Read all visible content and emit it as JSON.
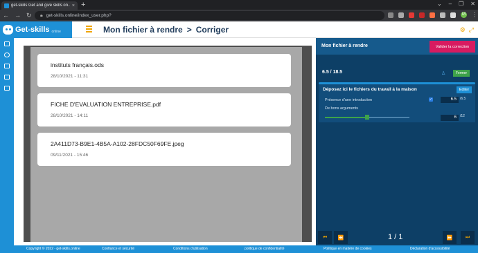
{
  "browser": {
    "tab_title": "get-skills Get and give skills on…",
    "tab_close": "×",
    "new_tab": "+",
    "url": "get-skills.online/index_user.php?",
    "window_controls": [
      "⌄",
      "–",
      "❐",
      "✕"
    ],
    "profile_initial": "M"
  },
  "header": {
    "logo_name": "Get-skills",
    "logo_sub": "online",
    "breadcrumb": [
      "Mon fichier à rendre",
      ">",
      "Corriger"
    ]
  },
  "files": [
    {
      "name": "instituts français.ods",
      "date": "28/10/2021 - 11:31"
    },
    {
      "name": "FICHE D'EVALUATION ENTREPRISE.pdf",
      "date": "28/10/2021 - 14:11"
    },
    {
      "name": "2A411D73-B9E1-4B5A-A102-28FDC50F69FE.jpeg",
      "date": "09/11/2021 - 15:46"
    }
  ],
  "panel": {
    "title": "Mon fichier à rendre",
    "validate_label": "Valider la correction",
    "score": "6.5 / 18.5",
    "fermer_label": "Fermer",
    "criteria_title": "Déposez ici le fichiers du travail à la maison",
    "edit_label": "Editer",
    "criteria": [
      {
        "label": "Présence d'une introduction",
        "checked": true,
        "value": "6.5",
        "max": "/6.5"
      },
      {
        "label": "De bons arguments",
        "value": "6",
        "max": "/12",
        "slider_fraction": 0.5
      }
    ],
    "page_indicator": "1 / 1"
  },
  "footer": {
    "links": [
      "Copyright © 2022 - get-skills.online",
      "Confiance et sécurité",
      "Conditions d'utilisation",
      "politique de confidentialité",
      "Politique en matière de cookies",
      "Déclaration d'accessibilité"
    ]
  },
  "colors": {
    "brand_blue": "#1e90d6",
    "panel_navy": "#0d3f66",
    "accent_orange": "#f0a500",
    "validate_pink": "#d81b60",
    "ok_green": "#3ea34a"
  }
}
